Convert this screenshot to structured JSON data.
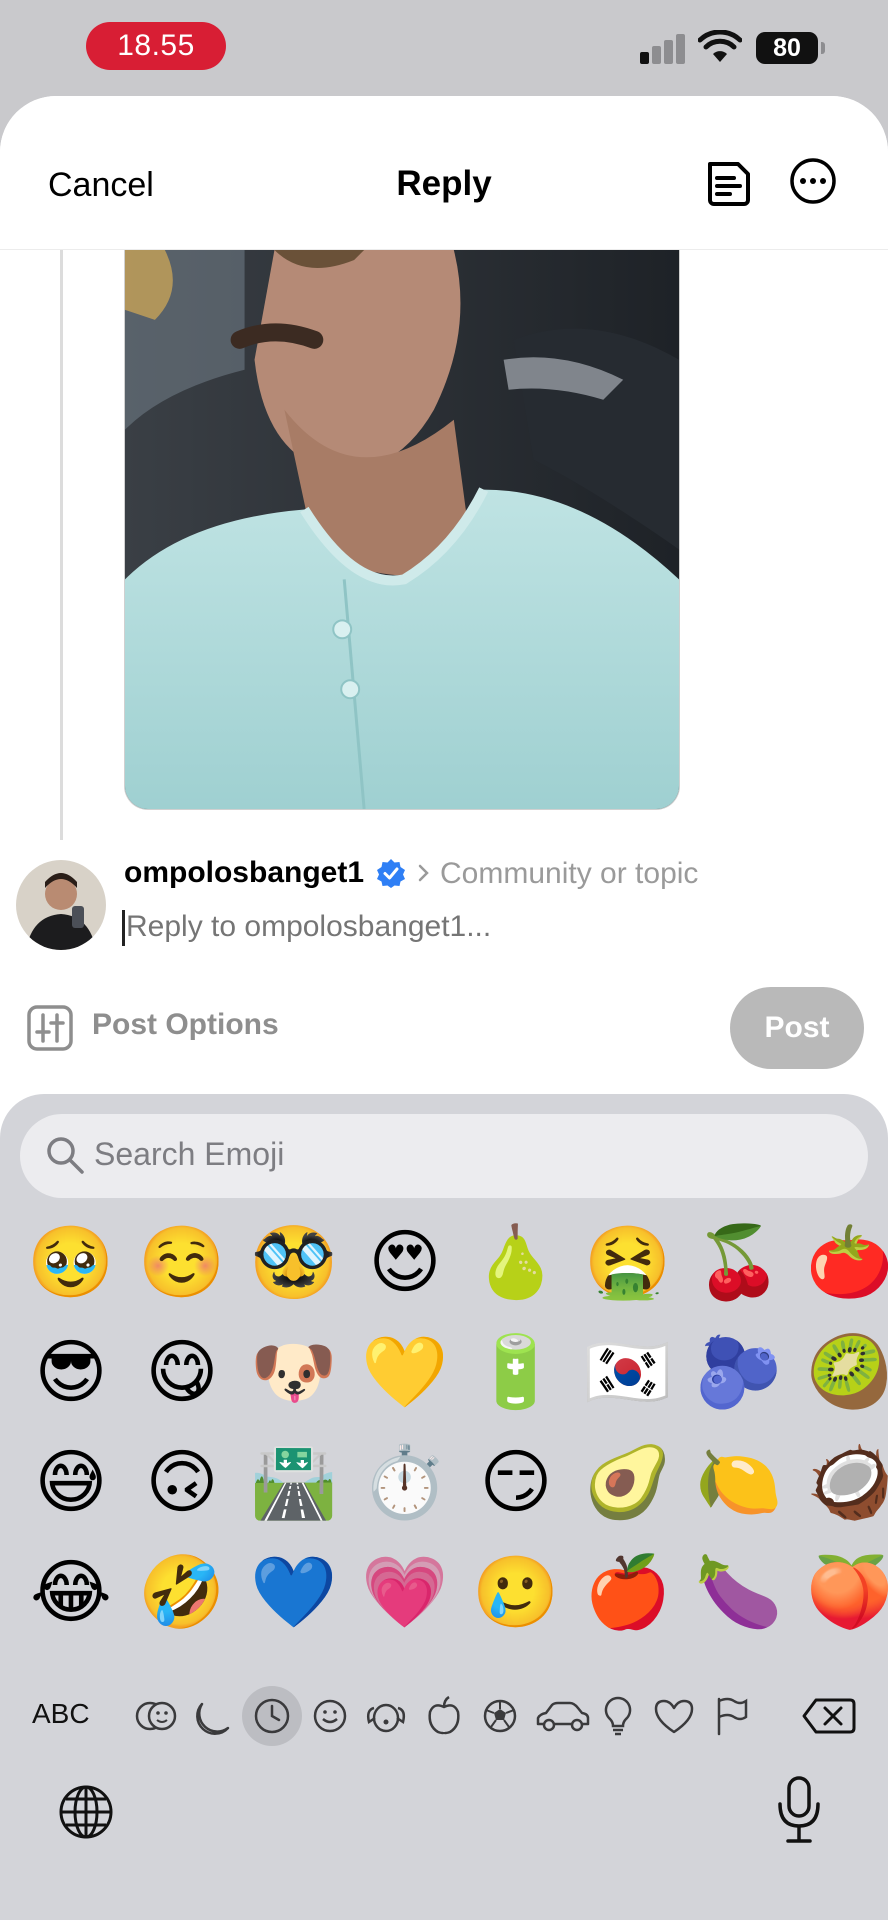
{
  "status_bar": {
    "time": "18.55",
    "battery": "80"
  },
  "header": {
    "cancel": "Cancel",
    "title": "Reply"
  },
  "composer": {
    "username": "ompolosbanget1",
    "community_placeholder": "Community or topic",
    "reply_placeholder": "Reply to ompolosbanget1..."
  },
  "options": {
    "label": "Post Options",
    "post_button": "Post"
  },
  "keyboard": {
    "search_placeholder": "Search Emoji",
    "abc_label": "ABC",
    "emoji_rows": [
      [
        "🥹",
        "☺️",
        "🥸",
        "😍",
        "🍐",
        "🤮",
        "🍒",
        "🍅"
      ],
      [
        "😎",
        "😋",
        "🐶",
        "💛",
        "🔋",
        "🇰🇷",
        "🫐",
        "🥝"
      ],
      [
        "😅",
        "🙃",
        "🛣️",
        "⏱️",
        "😏",
        "🥑",
        "🍋",
        "🥥"
      ],
      [
        "😂",
        "🤣",
        "💙",
        "💗",
        "🥲",
        "🍎",
        "🍆",
        "🍑"
      ]
    ],
    "categories": [
      "smileys-people-icon",
      "moon-icon",
      "recent-clock-icon",
      "smiley-icon",
      "animal-icon",
      "food-apple-icon",
      "ball-icon",
      "car-icon",
      "lightbulb-icon",
      "heart-icon",
      "flag-icon"
    ],
    "active_category": "recent-clock-icon"
  },
  "colors": {
    "time_pill": "#d81e34",
    "verified": "#2f7ff5",
    "post_button": "#b9b9b9",
    "keyboard_bg": "#d3d4d9"
  }
}
